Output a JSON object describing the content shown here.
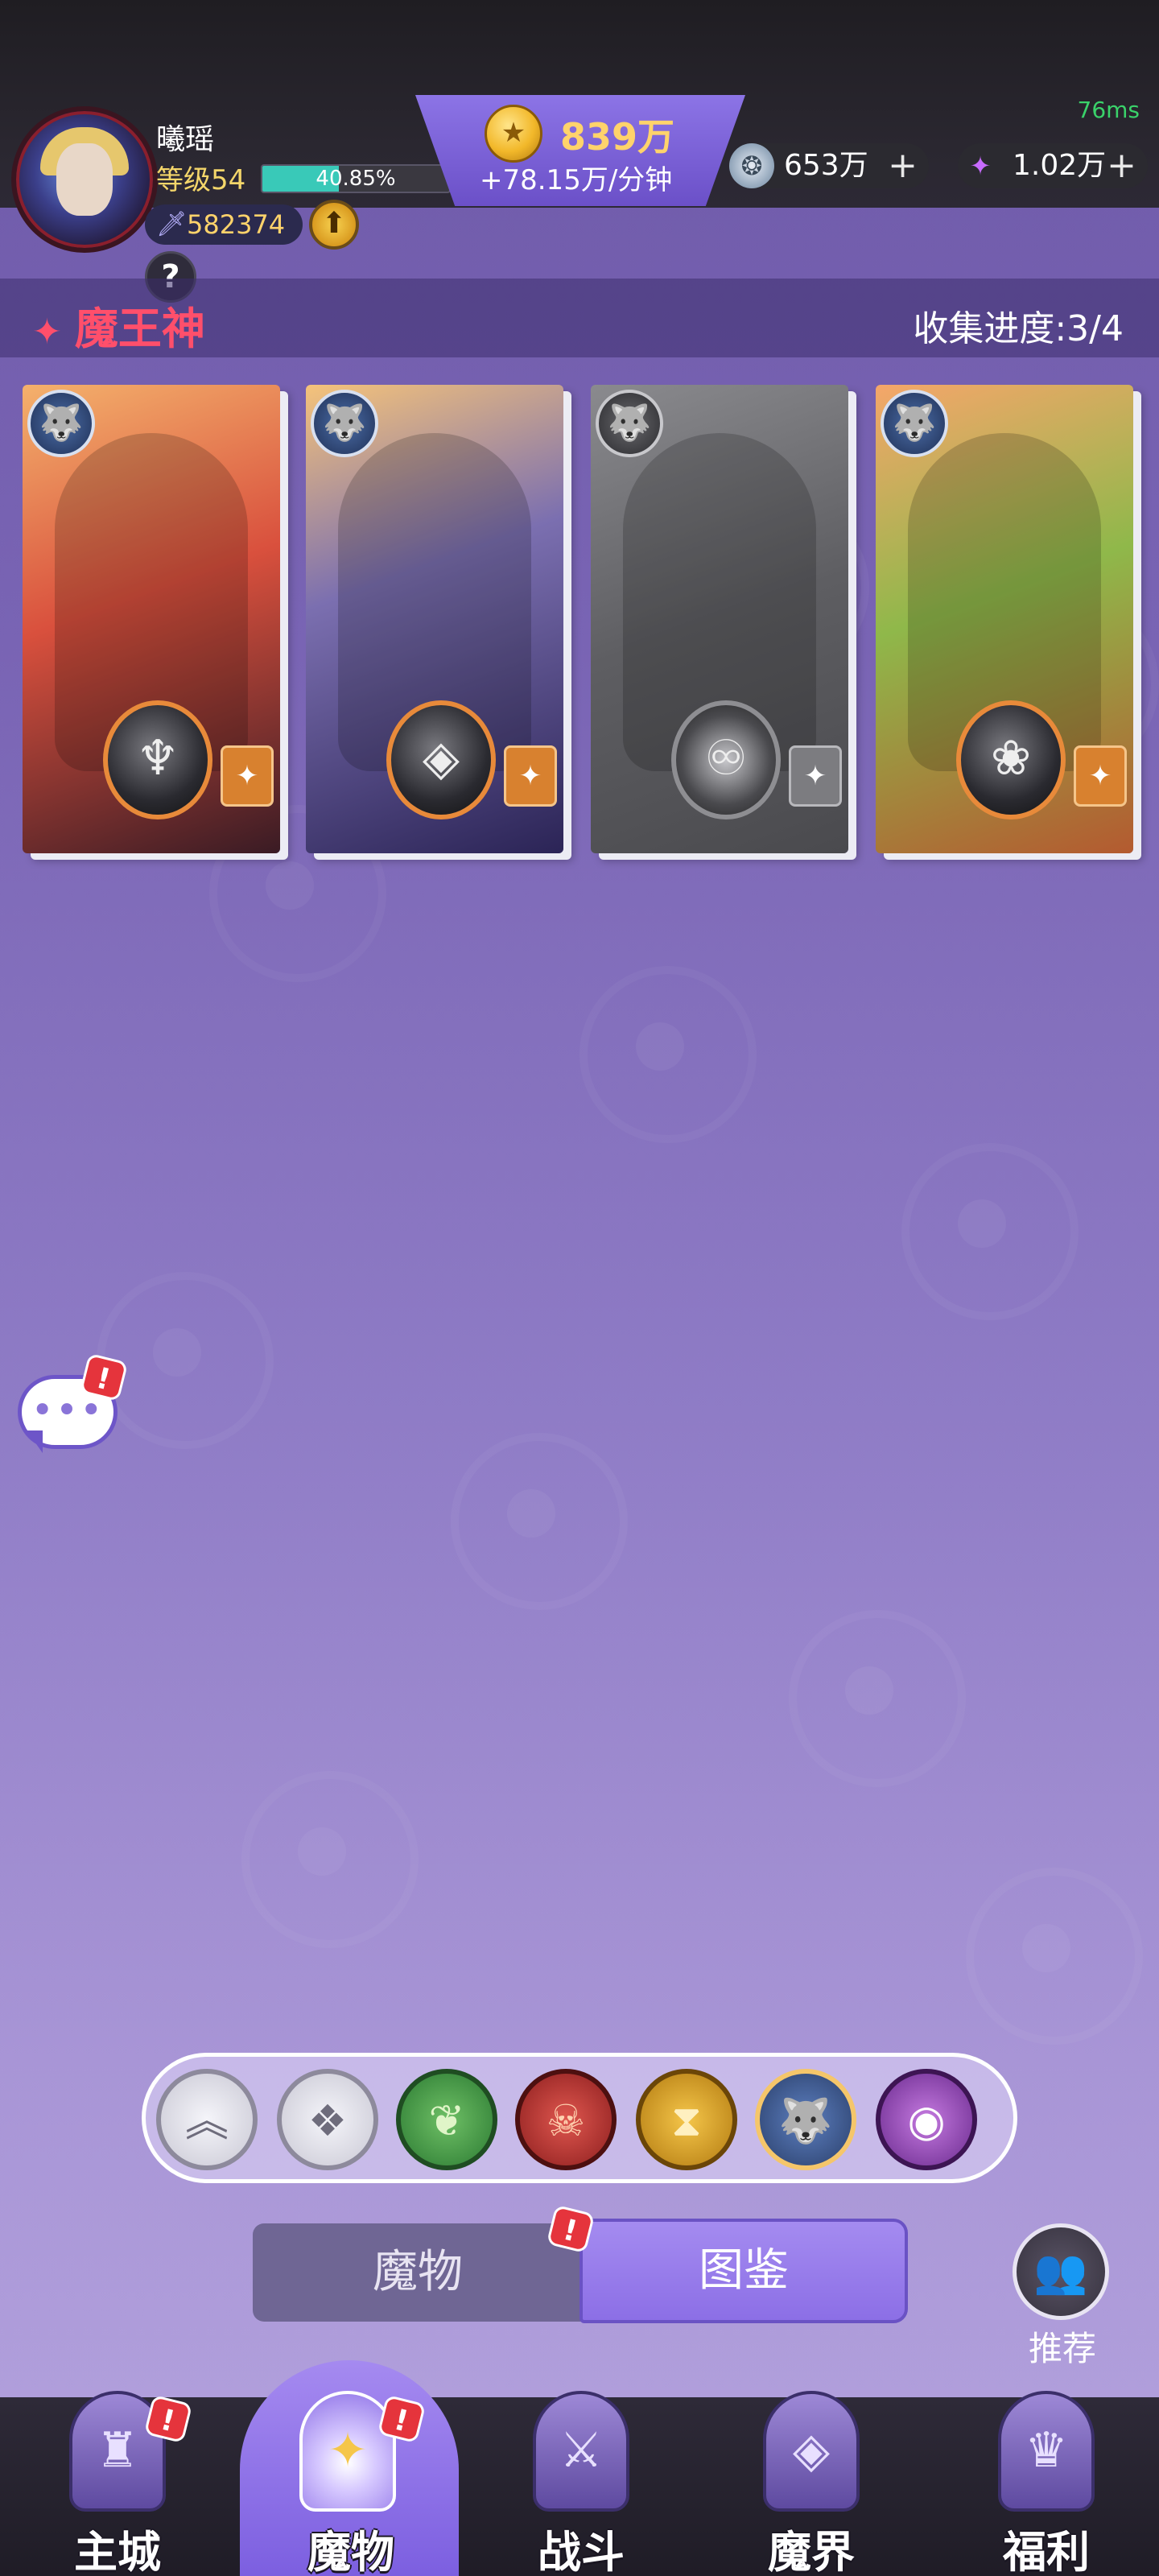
{
  "status": {
    "latency": "76ms"
  },
  "player": {
    "name": "曦瑶",
    "level_label": "等级54",
    "xp_percent_label": "40.85%",
    "xp_fraction": 0.4085,
    "power": "582374"
  },
  "resources": {
    "gold_amount": "839万",
    "gold_rate": "+78.15万/分钟",
    "silver_amount": "653万",
    "crystal_amount": "1.02万",
    "plus_symbol": "+"
  },
  "icons": {
    "help": "?",
    "upgrade": "⬆",
    "sword": "🗡",
    "coin": "★",
    "silver": "❂",
    "crystal": "✦",
    "wolf": "🐺",
    "chat": "•••",
    "alert": "!",
    "recommend": "👥",
    "star": "✦"
  },
  "section": {
    "title": "魔王神",
    "progress": "收集进度:3/4"
  },
  "cards": [
    {
      "name": "card-red-demoness",
      "owned": true,
      "emblem": "♆"
    },
    {
      "name": "card-shadow-dragon",
      "owned": true,
      "emblem": "◈"
    },
    {
      "name": "card-lion-locked",
      "owned": false,
      "emblem": "♾"
    },
    {
      "name": "card-green-dragon",
      "owned": true,
      "emblem": "❀"
    }
  ],
  "filters": [
    {
      "name": "filter-top",
      "glyph": "︽"
    },
    {
      "name": "filter-all",
      "glyph": "❖"
    },
    {
      "name": "filter-nature",
      "glyph": "❦"
    },
    {
      "name": "filter-demon",
      "glyph": "☠"
    },
    {
      "name": "filter-time",
      "glyph": "⧗"
    },
    {
      "name": "filter-beast",
      "glyph": "🐺",
      "selected": true
    },
    {
      "name": "filter-eye",
      "glyph": "◉"
    }
  ],
  "tabs": {
    "monster": "魔物",
    "codex": "图鉴",
    "active": "图鉴"
  },
  "recommend_label": "推荐",
  "nav": {
    "home": "主城",
    "monster": "魔物",
    "battle": "战斗",
    "realm": "魔界",
    "welfare": "福利",
    "active": "魔物"
  },
  "colors": {
    "accent": "#8c6fe6",
    "title_red": "#ff4f6b",
    "gold": "#ffd36b",
    "xp": "#39c9b8",
    "badge_red": "#e5343c"
  }
}
